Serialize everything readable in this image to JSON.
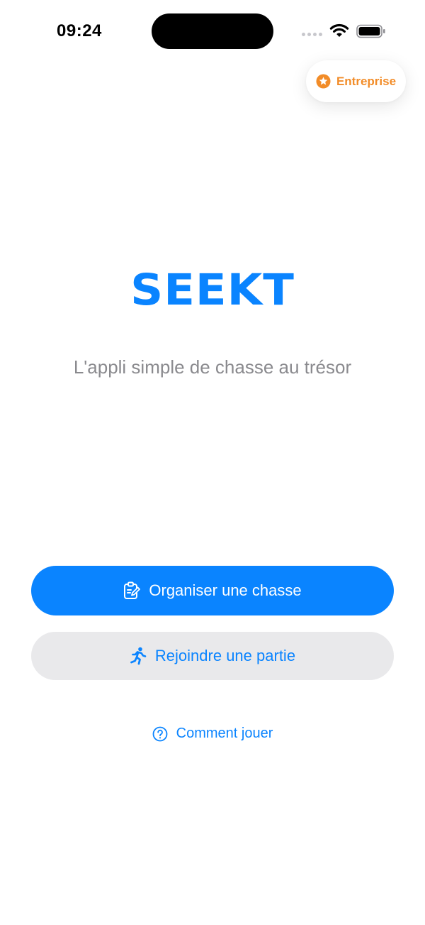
{
  "status_bar": {
    "time": "09:24"
  },
  "entreprise": {
    "label": "Entreprise",
    "icon": "star-circle-icon",
    "color": "#F28C28"
  },
  "brand": {
    "logo": "SEEKT",
    "tagline": "L'appli simple de chasse au trésor",
    "accent_color": "#0A84FF"
  },
  "actions": {
    "organize_label": "Organiser une chasse",
    "organize_icon": "clipboard-edit-icon",
    "join_label": "Rejoindre une partie",
    "join_icon": "running-person-icon",
    "help_label": "Comment jouer",
    "help_icon": "question-circle-icon"
  }
}
